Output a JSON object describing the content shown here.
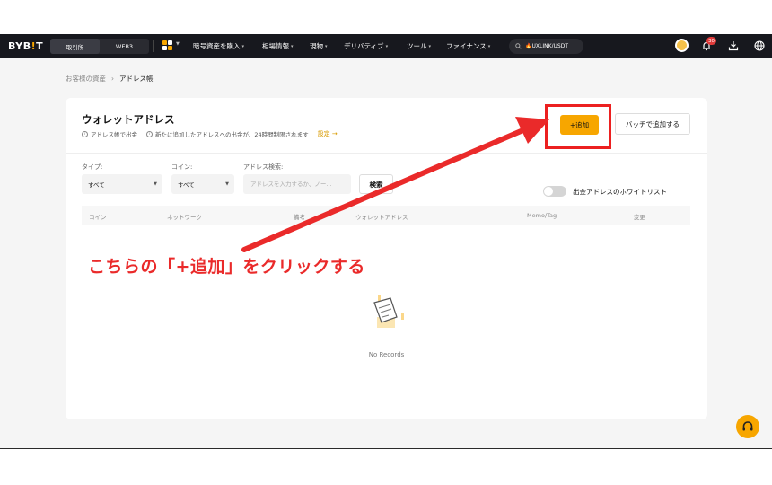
{
  "nav": {
    "logo_text": "BYB",
    "logo_i": "!",
    "logo_end": "T",
    "seg_exchange": "取引所",
    "seg_web3": "WEB3",
    "menu": [
      "暗号資産を購入",
      "相場情報",
      "現物",
      "デリバティブ",
      "ツール",
      "ファイナンス"
    ],
    "search_text": "🔥UXLINK/USDT",
    "notification_count": "30"
  },
  "breadcrumb": {
    "parent": "お客様の資産",
    "current": "アドレス帳"
  },
  "card": {
    "title": "ウォレットアドレス",
    "note1": "アドレス帳で出金",
    "note2": "新たに追加したアドレスへの出金が、24時間制限されます",
    "settings_link": "設定 →",
    "add_button": "+追加",
    "batch_button": "バッチで追加する"
  },
  "filters": {
    "type_label": "タイプ:",
    "type_value": "すべて",
    "coin_label": "コイン:",
    "coin_value": "すべて",
    "search_label": "アドレス検索:",
    "search_placeholder": "アドレスを入力するか、ノー...",
    "search_button": "検索",
    "whitelist_label": "出金アドレスのホワイトリスト"
  },
  "table": {
    "headers": [
      "コイン",
      "ネットワーク",
      "備考",
      "ウォレットアドレス",
      "Memo/Tag",
      "変更"
    ],
    "empty_text": "No Records"
  },
  "annotation": {
    "text": "こちらの「+追加」をクリックする",
    "color": "#ea2a2a"
  },
  "colors": {
    "accent": "#f7a600",
    "nav_bg": "#17181e",
    "highlight": "#ec2020"
  }
}
